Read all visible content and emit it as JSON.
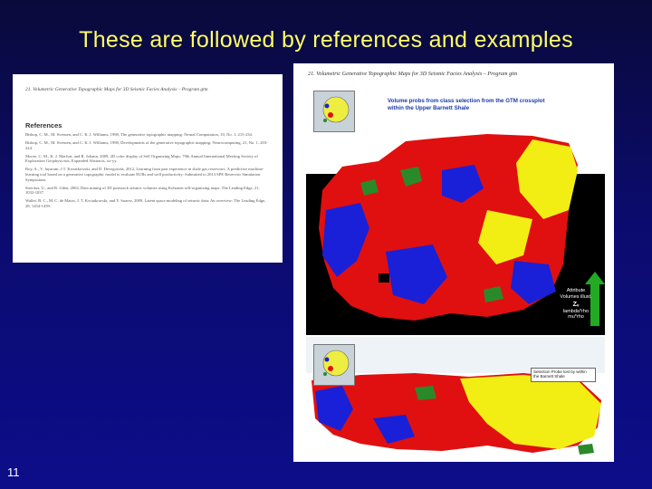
{
  "slide": {
    "title": "These are followed by references and examples",
    "number": "11"
  },
  "left_page": {
    "header": "21. Volumetric Generative Topographic Maps for 3D Seismic Facies Analysis – Program gtm",
    "heading": "References",
    "references": [
      "Bishop, C. M., M. Svensen, and C. K. I. Williams, 1998, The generative topographic mapping: Neural Computation, 10, No. 1, 215-234.",
      "Bishop, C. M., M. Svensen, and C. K. I. Williams, 1998, Developments of the generative topographic mapping: Neurocomputing, 21, No. 1, 203-224.",
      "Moore, C. M., K. J. Marfurt, and R. Johann, 2009, 2D color display of Self Organizing Maps: 79th Annual International Meeting Society of Exploration Geophysicists, Expanded Abstracts, xx-yy.",
      "Roy, A., V. Jayaram, J.T. Kwiatkowski, and D. Devegowda, 2012, Learning from past experience in shale gas reservoirs: A predictive machine-learning tool based on a generative topographic model to evaluate EURs and well productivity: Submitted to 2013 SPE Reservoir Simulation Symposium.",
      "Strecker, U., and R. Uden, 2002, Data mining of 3D poststack seismic volumes using Kohonen self-organizing maps: The Leading Edge, 21, 1032-1037.",
      "Wallet, B. C., M. C. de Matos, J. T. Kwiatkowski, and Y. Suarez, 2009, Latent space modeling of seismic data: An overview: The Leading Edge, 28, 1454-1459."
    ]
  },
  "right_page": {
    "header": "21. Volumetric Generative Topographic Maps for 3D Seismic Facies Analysis – Program gtm",
    "caption_line1": "Volume probs from class selection from the GTM crossplot",
    "caption_line2": "within the Upper Barnett Shale",
    "attribute_label_line1": "Attribute",
    "attribute_label_line2": "Volumes illust.",
    "attribute_value": "Zᵥ",
    "attribute_label_line3": "lambda*rho",
    "attribute_label_line4": "mu*rho",
    "note_box": "Selection Probe lost by within the Barnett Shale",
    "colors": {
      "red": "#e01010",
      "yellow": "#f2ee14",
      "blue": "#1a20d8",
      "green": "#2a8a2a",
      "caption_blue": "#1a3aa6"
    }
  }
}
